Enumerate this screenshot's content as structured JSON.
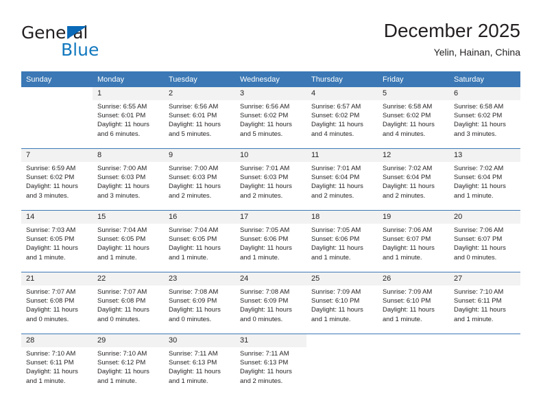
{
  "brand": {
    "name_top": "General",
    "name_bottom": "Blue",
    "triangle_color": "#0b6ab8",
    "text_color": "#231f20",
    "blue_color": "#1278be"
  },
  "header": {
    "title": "December 2025",
    "location": "Yelin, Hainan, China"
  },
  "theme": {
    "header_bg": "#3b78b5",
    "header_text": "#ffffff",
    "date_band_bg": "#f2f2f2",
    "cell_bg": "#ffffff",
    "row_divider": "#3b78b5",
    "body_text": "#231f20"
  },
  "weekday_headers": [
    "Sunday",
    "Monday",
    "Tuesday",
    "Wednesday",
    "Thursday",
    "Friday",
    "Saturday"
  ],
  "weeks": [
    [
      {
        "day": "",
        "blank": true,
        "sunrise": "",
        "sunset": "",
        "daylight": ""
      },
      {
        "day": "1",
        "sunrise": "Sunrise: 6:55 AM",
        "sunset": "Sunset: 6:01 PM",
        "daylight": "Daylight: 11 hours and 6 minutes."
      },
      {
        "day": "2",
        "sunrise": "Sunrise: 6:56 AM",
        "sunset": "Sunset: 6:01 PM",
        "daylight": "Daylight: 11 hours and 5 minutes."
      },
      {
        "day": "3",
        "sunrise": "Sunrise: 6:56 AM",
        "sunset": "Sunset: 6:02 PM",
        "daylight": "Daylight: 11 hours and 5 minutes."
      },
      {
        "day": "4",
        "sunrise": "Sunrise: 6:57 AM",
        "sunset": "Sunset: 6:02 PM",
        "daylight": "Daylight: 11 hours and 4 minutes."
      },
      {
        "day": "5",
        "sunrise": "Sunrise: 6:58 AM",
        "sunset": "Sunset: 6:02 PM",
        "daylight": "Daylight: 11 hours and 4 minutes."
      },
      {
        "day": "6",
        "sunrise": "Sunrise: 6:58 AM",
        "sunset": "Sunset: 6:02 PM",
        "daylight": "Daylight: 11 hours and 3 minutes."
      }
    ],
    [
      {
        "day": "7",
        "sunrise": "Sunrise: 6:59 AM",
        "sunset": "Sunset: 6:02 PM",
        "daylight": "Daylight: 11 hours and 3 minutes."
      },
      {
        "day": "8",
        "sunrise": "Sunrise: 7:00 AM",
        "sunset": "Sunset: 6:03 PM",
        "daylight": "Daylight: 11 hours and 3 minutes."
      },
      {
        "day": "9",
        "sunrise": "Sunrise: 7:00 AM",
        "sunset": "Sunset: 6:03 PM",
        "daylight": "Daylight: 11 hours and 2 minutes."
      },
      {
        "day": "10",
        "sunrise": "Sunrise: 7:01 AM",
        "sunset": "Sunset: 6:03 PM",
        "daylight": "Daylight: 11 hours and 2 minutes."
      },
      {
        "day": "11",
        "sunrise": "Sunrise: 7:01 AM",
        "sunset": "Sunset: 6:04 PM",
        "daylight": "Daylight: 11 hours and 2 minutes."
      },
      {
        "day": "12",
        "sunrise": "Sunrise: 7:02 AM",
        "sunset": "Sunset: 6:04 PM",
        "daylight": "Daylight: 11 hours and 2 minutes."
      },
      {
        "day": "13",
        "sunrise": "Sunrise: 7:02 AM",
        "sunset": "Sunset: 6:04 PM",
        "daylight": "Daylight: 11 hours and 1 minute."
      }
    ],
    [
      {
        "day": "14",
        "sunrise": "Sunrise: 7:03 AM",
        "sunset": "Sunset: 6:05 PM",
        "daylight": "Daylight: 11 hours and 1 minute."
      },
      {
        "day": "15",
        "sunrise": "Sunrise: 7:04 AM",
        "sunset": "Sunset: 6:05 PM",
        "daylight": "Daylight: 11 hours and 1 minute."
      },
      {
        "day": "16",
        "sunrise": "Sunrise: 7:04 AM",
        "sunset": "Sunset: 6:05 PM",
        "daylight": "Daylight: 11 hours and 1 minute."
      },
      {
        "day": "17",
        "sunrise": "Sunrise: 7:05 AM",
        "sunset": "Sunset: 6:06 PM",
        "daylight": "Daylight: 11 hours and 1 minute."
      },
      {
        "day": "18",
        "sunrise": "Sunrise: 7:05 AM",
        "sunset": "Sunset: 6:06 PM",
        "daylight": "Daylight: 11 hours and 1 minute."
      },
      {
        "day": "19",
        "sunrise": "Sunrise: 7:06 AM",
        "sunset": "Sunset: 6:07 PM",
        "daylight": "Daylight: 11 hours and 1 minute."
      },
      {
        "day": "20",
        "sunrise": "Sunrise: 7:06 AM",
        "sunset": "Sunset: 6:07 PM",
        "daylight": "Daylight: 11 hours and 0 minutes."
      }
    ],
    [
      {
        "day": "21",
        "sunrise": "Sunrise: 7:07 AM",
        "sunset": "Sunset: 6:08 PM",
        "daylight": "Daylight: 11 hours and 0 minutes."
      },
      {
        "day": "22",
        "sunrise": "Sunrise: 7:07 AM",
        "sunset": "Sunset: 6:08 PM",
        "daylight": "Daylight: 11 hours and 0 minutes."
      },
      {
        "day": "23",
        "sunrise": "Sunrise: 7:08 AM",
        "sunset": "Sunset: 6:09 PM",
        "daylight": "Daylight: 11 hours and 0 minutes."
      },
      {
        "day": "24",
        "sunrise": "Sunrise: 7:08 AM",
        "sunset": "Sunset: 6:09 PM",
        "daylight": "Daylight: 11 hours and 0 minutes."
      },
      {
        "day": "25",
        "sunrise": "Sunrise: 7:09 AM",
        "sunset": "Sunset: 6:10 PM",
        "daylight": "Daylight: 11 hours and 1 minute."
      },
      {
        "day": "26",
        "sunrise": "Sunrise: 7:09 AM",
        "sunset": "Sunset: 6:10 PM",
        "daylight": "Daylight: 11 hours and 1 minute."
      },
      {
        "day": "27",
        "sunrise": "Sunrise: 7:10 AM",
        "sunset": "Sunset: 6:11 PM",
        "daylight": "Daylight: 11 hours and 1 minute."
      }
    ],
    [
      {
        "day": "28",
        "sunrise": "Sunrise: 7:10 AM",
        "sunset": "Sunset: 6:11 PM",
        "daylight": "Daylight: 11 hours and 1 minute."
      },
      {
        "day": "29",
        "sunrise": "Sunrise: 7:10 AM",
        "sunset": "Sunset: 6:12 PM",
        "daylight": "Daylight: 11 hours and 1 minute."
      },
      {
        "day": "30",
        "sunrise": "Sunrise: 7:11 AM",
        "sunset": "Sunset: 6:13 PM",
        "daylight": "Daylight: 11 hours and 1 minute."
      },
      {
        "day": "31",
        "sunrise": "Sunrise: 7:11 AM",
        "sunset": "Sunset: 6:13 PM",
        "daylight": "Daylight: 11 hours and 2 minutes."
      },
      {
        "day": "",
        "blank": true,
        "sunrise": "",
        "sunset": "",
        "daylight": ""
      },
      {
        "day": "",
        "blank": true,
        "sunrise": "",
        "sunset": "",
        "daylight": ""
      },
      {
        "day": "",
        "blank": true,
        "sunrise": "",
        "sunset": "",
        "daylight": ""
      }
    ]
  ]
}
